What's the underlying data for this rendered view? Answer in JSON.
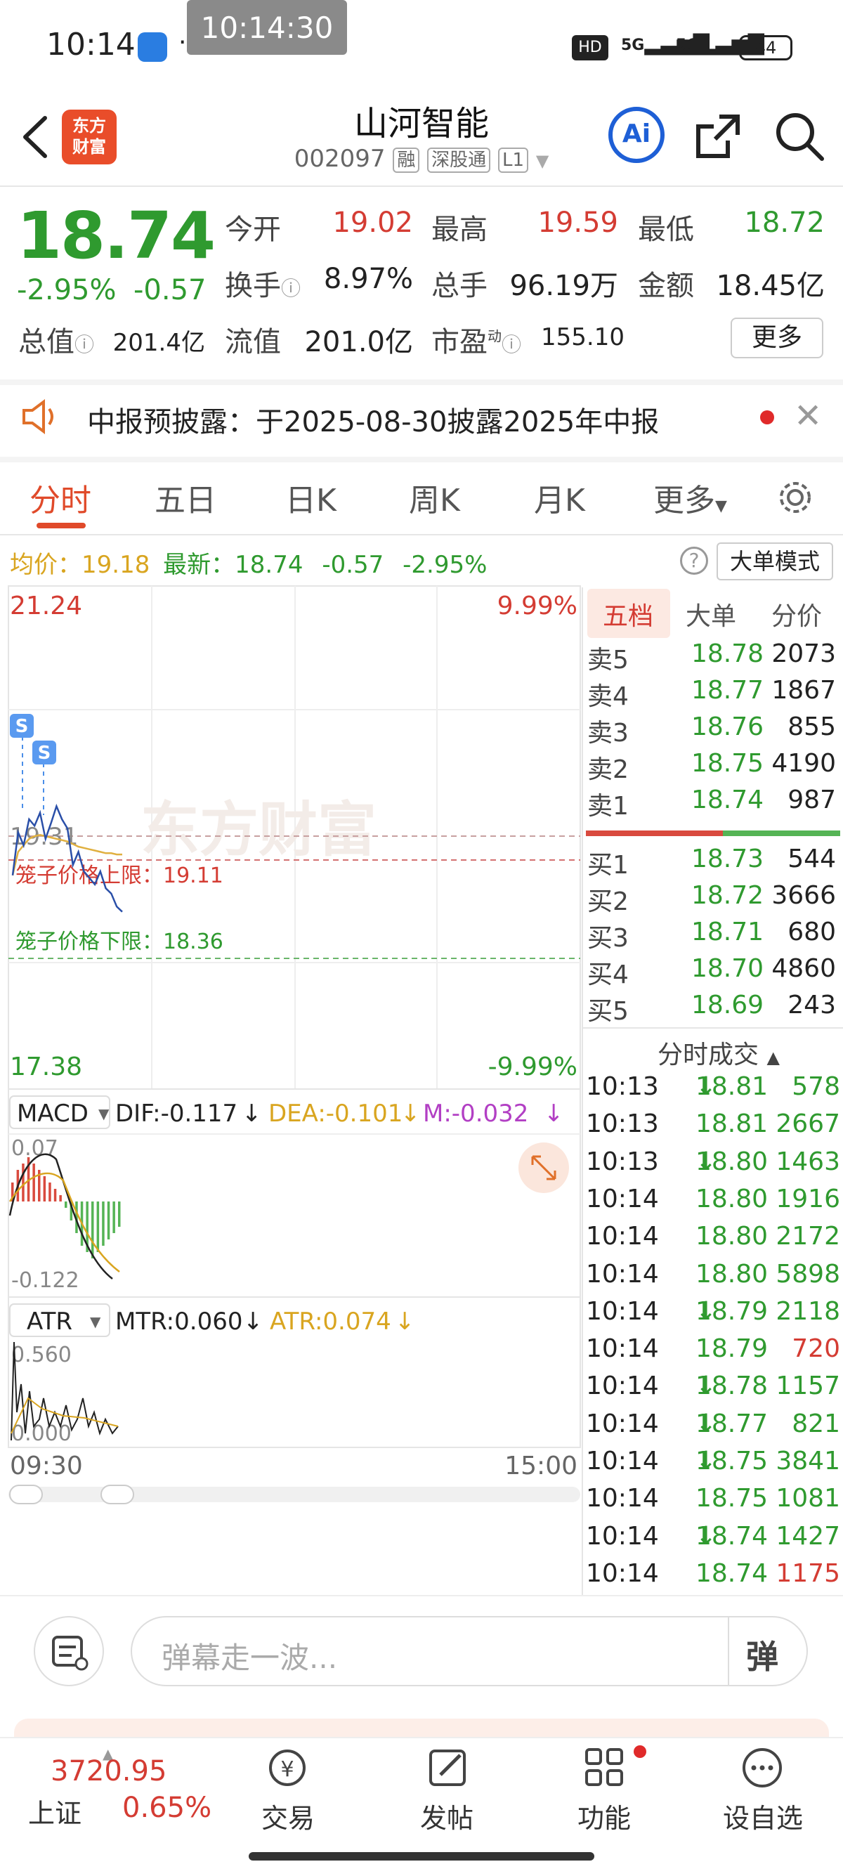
{
  "status": {
    "time": "10:14",
    "time_tip": "10:14:30",
    "network1": "5G",
    "network2": "5G",
    "battery": "44",
    "hd": "HD"
  },
  "header": {
    "logo": "东方\n财富",
    "name": "山河智能",
    "code": "002097",
    "tag1": "融",
    "tag2": "深股通",
    "tag3": "L1",
    "ai": "Ai"
  },
  "quote": {
    "price": "18.74",
    "change_pct": "-2.95%",
    "change_abs": "-0.57",
    "open_label": "今开",
    "open": "19.02",
    "high_label": "最高",
    "high": "19.59",
    "low_label": "最低",
    "low": "18.72",
    "turnover_label": "换手",
    "turnover": "8.97%",
    "volume_label": "总手",
    "volume": "96.19万",
    "amount_label": "金额",
    "amount": "18.45亿",
    "mcap_label": "总值",
    "mcap": "201.4亿",
    "float_label": "流值",
    "float": "201.0亿",
    "pe_label": "市盈",
    "pe_sup": "动",
    "pe": "155.10",
    "more": "更多"
  },
  "notice": {
    "text": "中报预披露：于2025-08-30披露2025年中报"
  },
  "tabs": [
    "分时",
    "五日",
    "日K",
    "周K",
    "月K",
    "更多"
  ],
  "infoline": {
    "avg_label": "均价：",
    "avg": "19.18",
    "latest_label": "最新：",
    "latest": "18.74",
    "chg": "-0.57",
    "pct": "-2.95%",
    "mode": "大单模式"
  },
  "chart": {
    "y_top": "21.24",
    "y_bottom": "17.38",
    "pct_top": "9.99%",
    "pct_bottom": "-9.99%",
    "y_mid_label": "19.31",
    "watermark": "东方财富",
    "cage_upper": "笼子价格上限：19.11",
    "cage_lower": "笼子价格下限：18.36",
    "signal": "S",
    "macd_name": "MACD",
    "dif": "DIF:-0.117",
    "dea": "DEA:-0.101",
    "m": "M:-0.032",
    "macd_top": "0.07",
    "macd_bottom": "-0.122",
    "atr_name": "ATR",
    "mtr": "MTR:0.060",
    "atr": "ATR:0.074",
    "atr_top": "0.560",
    "atr_bottom": "0.000",
    "time_start": "09:30",
    "time_end": "15:00",
    "price_series": [
      19.02,
      19.35,
      19.25,
      19.45,
      19.4,
      19.5,
      19.3,
      19.42,
      19.55,
      19.45,
      19.38,
      19.1,
      19.2,
      19.05,
      19.0,
      18.95,
      19.05,
      18.92,
      18.88,
      18.78,
      18.74
    ],
    "avg_series": [
      19.02,
      19.2,
      19.25,
      19.3,
      19.32,
      19.33,
      19.32,
      19.31,
      19.3,
      19.29,
      19.28,
      19.26,
      19.24,
      19.23,
      19.22,
      19.21,
      19.2,
      19.19,
      19.19,
      19.18,
      19.18
    ],
    "macd_bars": [
      0.03,
      0.05,
      0.06,
      0.07,
      0.06,
      0.05,
      0.04,
      0.03,
      0.02,
      0.01,
      -0.01,
      -0.03,
      -0.05,
      -0.07,
      -0.08,
      -0.09,
      -0.08,
      -0.07,
      -0.06,
      -0.05,
      -0.04
    ]
  },
  "orderbook": {
    "tabs": [
      "五档",
      "大单",
      "分价"
    ],
    "sells": [
      {
        "label": "卖5",
        "price": "18.78",
        "vol": "2073"
      },
      {
        "label": "卖4",
        "price": "18.77",
        "vol": "1867"
      },
      {
        "label": "卖3",
        "price": "18.76",
        "vol": "855"
      },
      {
        "label": "卖2",
        "price": "18.75",
        "vol": "4190"
      },
      {
        "label": "卖1",
        "price": "18.74",
        "vol": "987"
      }
    ],
    "buys": [
      {
        "label": "买1",
        "price": "18.73",
        "vol": "544"
      },
      {
        "label": "买2",
        "price": "18.72",
        "vol": "3666"
      },
      {
        "label": "买3",
        "price": "18.71",
        "vol": "680"
      },
      {
        "label": "买4",
        "price": "18.70",
        "vol": "4860"
      },
      {
        "label": "买5",
        "price": "18.69",
        "vol": "243"
      }
    ],
    "trades_title": "分时成交",
    "trades": [
      {
        "t": "10:13",
        "p": "18.81",
        "dir": "↓",
        "v": "578",
        "c": "green"
      },
      {
        "t": "10:13",
        "p": "18.81",
        "dir": "",
        "v": "2667",
        "c": "green"
      },
      {
        "t": "10:13",
        "p": "18.80",
        "dir": "↓",
        "v": "1463",
        "c": "green"
      },
      {
        "t": "10:14",
        "p": "18.80",
        "dir": "",
        "v": "1916",
        "c": "green"
      },
      {
        "t": "10:14",
        "p": "18.80",
        "dir": "",
        "v": "2172",
        "c": "green"
      },
      {
        "t": "10:14",
        "p": "18.80",
        "dir": "",
        "v": "5898",
        "c": "green"
      },
      {
        "t": "10:14",
        "p": "18.79",
        "dir": "↓",
        "v": "2118",
        "c": "green"
      },
      {
        "t": "10:14",
        "p": "18.79",
        "dir": "",
        "v": "720",
        "c": "red"
      },
      {
        "t": "10:14",
        "p": "18.78",
        "dir": "↓",
        "v": "1157",
        "c": "green"
      },
      {
        "t": "10:14",
        "p": "18.77",
        "dir": "↓",
        "v": "821",
        "c": "green"
      },
      {
        "t": "10:14",
        "p": "18.75",
        "dir": "↓",
        "v": "3841",
        "c": "green"
      },
      {
        "t": "10:14",
        "p": "18.75",
        "dir": "",
        "v": "1081",
        "c": "green"
      },
      {
        "t": "10:14",
        "p": "18.74",
        "dir": "↓",
        "v": "1427",
        "c": "green"
      },
      {
        "t": "10:14",
        "p": "18.74",
        "dir": "",
        "v": "1175",
        "c": "red"
      }
    ]
  },
  "comment": {
    "placeholder": "弹幕走一波...",
    "danmaku": "弹"
  },
  "bottom": {
    "index_value": "3720.95",
    "index_name": "上证",
    "index_pct": "0.65%",
    "trade": "交易",
    "post": "发帖",
    "func": "功能",
    "watch": "设自选"
  }
}
